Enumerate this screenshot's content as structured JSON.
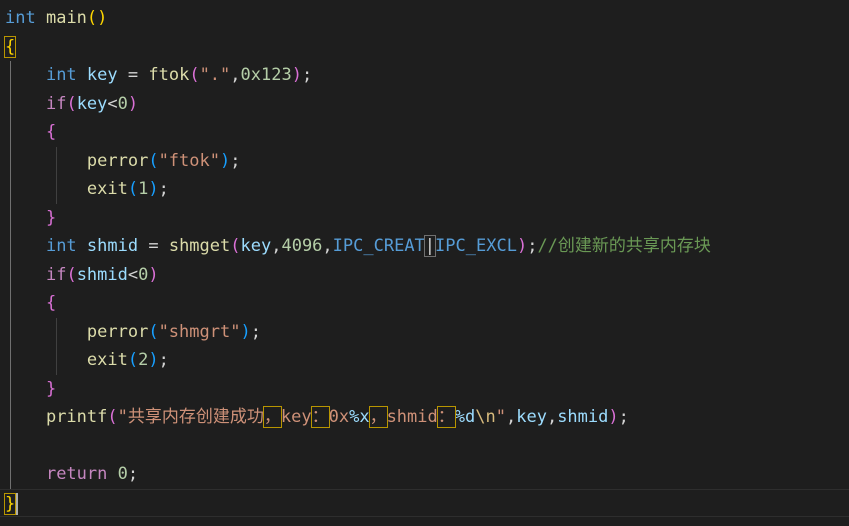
{
  "editor": {
    "language": "c",
    "cursor_line": 18,
    "lines": [
      {
        "n": 1,
        "tokens": [
          [
            "kw",
            "int"
          ],
          [
            "pun",
            " "
          ],
          [
            "fn",
            "main"
          ],
          [
            "b1",
            "()"
          ]
        ]
      },
      {
        "n": 2,
        "tokens": [
          [
            "b1 bm",
            "{"
          ]
        ]
      },
      {
        "n": 3,
        "tokens": [
          [
            "pun",
            "    "
          ],
          [
            "kw",
            "int"
          ],
          [
            "pun",
            " "
          ],
          [
            "var",
            "key"
          ],
          [
            "pun",
            " = "
          ],
          [
            "fn",
            "ftok"
          ],
          [
            "b2",
            "("
          ],
          [
            "str",
            "\".\""
          ],
          [
            "pun",
            ","
          ],
          [
            "num",
            "0x123"
          ],
          [
            "b2",
            ")"
          ],
          [
            "pun",
            ";"
          ]
        ]
      },
      {
        "n": 4,
        "tokens": [
          [
            "pun",
            "    "
          ],
          [
            "ctl",
            "if"
          ],
          [
            "b2",
            "("
          ],
          [
            "var",
            "key"
          ],
          [
            "pun",
            "<"
          ],
          [
            "num",
            "0"
          ],
          [
            "b2",
            ")"
          ]
        ]
      },
      {
        "n": 5,
        "tokens": [
          [
            "pun",
            "    "
          ],
          [
            "b2",
            "{"
          ]
        ]
      },
      {
        "n": 6,
        "tokens": [
          [
            "pun",
            "        "
          ],
          [
            "fn",
            "perror"
          ],
          [
            "b3",
            "("
          ],
          [
            "str",
            "\"ftok\""
          ],
          [
            "b3",
            ")"
          ],
          [
            "pun",
            ";"
          ]
        ]
      },
      {
        "n": 7,
        "tokens": [
          [
            "pun",
            "        "
          ],
          [
            "fn",
            "exit"
          ],
          [
            "b3",
            "("
          ],
          [
            "num",
            "1"
          ],
          [
            "b3",
            ")"
          ],
          [
            "pun",
            ";"
          ]
        ]
      },
      {
        "n": 8,
        "tokens": [
          [
            "pun",
            "    "
          ],
          [
            "b2",
            "}"
          ]
        ]
      },
      {
        "n": 9,
        "tokens": [
          [
            "pun",
            "    "
          ],
          [
            "kw",
            "int"
          ],
          [
            "pun",
            " "
          ],
          [
            "var",
            "shmid"
          ],
          [
            "pun",
            " = "
          ],
          [
            "fn",
            "shmget"
          ],
          [
            "b2",
            "("
          ],
          [
            "var",
            "key"
          ],
          [
            "pun",
            ","
          ],
          [
            "num",
            "4096"
          ],
          [
            "pun",
            ","
          ],
          [
            "mac",
            "IPC_CREAT"
          ],
          [
            "pun pipe",
            "|"
          ],
          [
            "mac",
            "IPC_EXCL"
          ],
          [
            "b2",
            ")"
          ],
          [
            "pun",
            ";"
          ],
          [
            "cmt",
            "//创建新的共享内存块"
          ]
        ]
      },
      {
        "n": 10,
        "tokens": [
          [
            "pun",
            "    "
          ],
          [
            "ctl",
            "if"
          ],
          [
            "b2",
            "("
          ],
          [
            "var",
            "shmid"
          ],
          [
            "pun",
            "<"
          ],
          [
            "num",
            "0"
          ],
          [
            "b2",
            ")"
          ]
        ]
      },
      {
        "n": 11,
        "tokens": [
          [
            "pun",
            "    "
          ],
          [
            "b2",
            "{"
          ]
        ]
      },
      {
        "n": 12,
        "tokens": [
          [
            "pun",
            "        "
          ],
          [
            "fn",
            "perror"
          ],
          [
            "b3",
            "("
          ],
          [
            "str",
            "\"shmgrt\""
          ],
          [
            "b3",
            ")"
          ],
          [
            "pun",
            ";"
          ]
        ]
      },
      {
        "n": 13,
        "tokens": [
          [
            "pun",
            "        "
          ],
          [
            "fn",
            "exit"
          ],
          [
            "b3",
            "("
          ],
          [
            "num",
            "2"
          ],
          [
            "b3",
            ")"
          ],
          [
            "pun",
            ";"
          ]
        ]
      },
      {
        "n": 14,
        "tokens": [
          [
            "pun",
            "    "
          ],
          [
            "b2",
            "}"
          ]
        ]
      },
      {
        "n": 15,
        "tokens": [
          [
            "pun",
            "    "
          ],
          [
            "fn",
            "printf"
          ],
          [
            "b2",
            "("
          ],
          [
            "str",
            "\"共享内存创建成功"
          ],
          [
            "str wc",
            "，"
          ],
          [
            "str",
            "key"
          ],
          [
            "str wc",
            "："
          ],
          [
            "str",
            "0x"
          ],
          [
            "fmt",
            "%x"
          ],
          [
            "str wc",
            "，"
          ],
          [
            "str",
            "shmid"
          ],
          [
            "str wc",
            "："
          ],
          [
            "fmt",
            "%d"
          ],
          [
            "esc",
            "\\n"
          ],
          [
            "str",
            "\""
          ],
          [
            "pun",
            ","
          ],
          [
            "var",
            "key"
          ],
          [
            "pun",
            ","
          ],
          [
            "var",
            "shmid"
          ],
          [
            "b2",
            ")"
          ],
          [
            "pun",
            ";"
          ]
        ]
      },
      {
        "n": 16,
        "tokens": []
      },
      {
        "n": 17,
        "tokens": [
          [
            "pun",
            "    "
          ],
          [
            "ctl",
            "return"
          ],
          [
            "pun",
            " "
          ],
          [
            "num",
            "0"
          ],
          [
            "pun",
            ";"
          ]
        ]
      },
      {
        "n": 18,
        "tokens": [
          [
            "b1 bm",
            "}"
          ]
        ]
      }
    ]
  },
  "colors": {
    "background": "#1e1e1e",
    "keyword": "#569cd6",
    "control": "#c586c0",
    "function": "#dcdcaa",
    "variable": "#9cdcfe",
    "number": "#b5cea8",
    "string": "#ce9178",
    "comment": "#6a9955",
    "bracket_level1": "#ffd700",
    "bracket_level2": "#da70d6",
    "bracket_level3": "#179fff"
  }
}
